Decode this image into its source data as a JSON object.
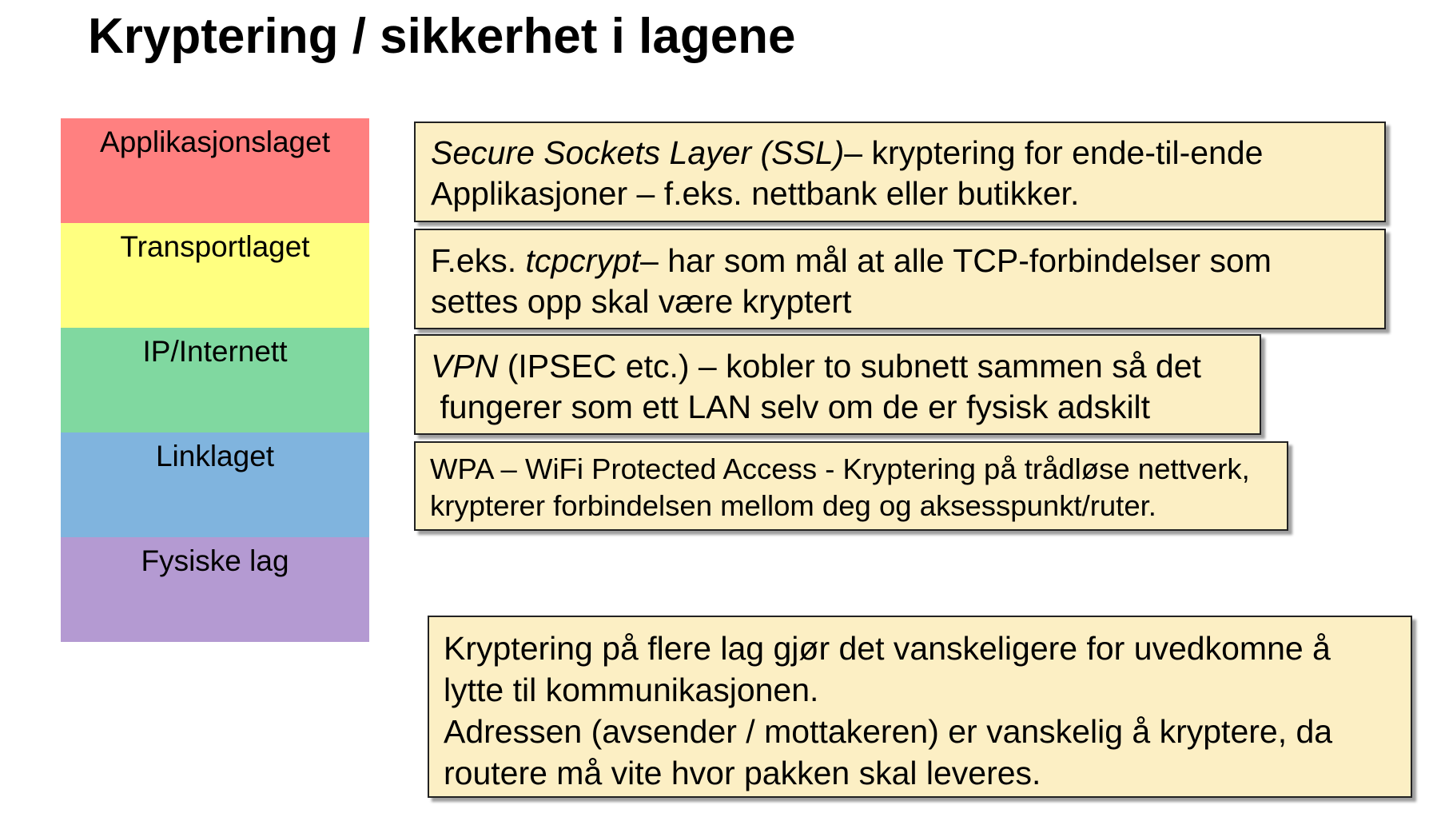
{
  "title": "Kryptering / sikkerhet i lagene",
  "layers": [
    {
      "label": "Applikasjonslaget",
      "color": "#ff8080"
    },
    {
      "label": "Transportlaget",
      "color": "#ffff80"
    },
    {
      "label": "IP/Internett",
      "color": "#80d8a0"
    },
    {
      "label": "Linklaget",
      "color": "#80b4de"
    },
    {
      "label": "Fysiske lag",
      "color": "#b49ad2"
    }
  ],
  "boxes": {
    "ssl": {
      "term": "Secure Sockets Layer (SSL)",
      "text1": "– kryptering for ende-til-ende",
      "line2": "Applikasjoner – f.eks. nettbank eller butikker."
    },
    "tcp": {
      "prefix": "F.eks. ",
      "term": "tcpcrypt",
      "text1": "– har som mål at alle TCP-forbindelser som",
      "line2": "settes opp skal være kryptert"
    },
    "vpn": {
      "term": "VPN",
      "text1": " (IPSEC etc.) – kobler to subnett sammen så det",
      "line2": " fungerer som ett LAN selv om de er fysisk adskilt"
    },
    "wpa": {
      "line1": "WPA – WiFi Protected Access - Kryptering på trådløse nettverk,",
      "line2": "krypterer forbindelsen mellom deg og aksesspunkt/ruter."
    },
    "note": {
      "line1": "Kryptering på flere lag gjør det vanskeligere for uvedkomne å",
      "line2": "lytte til kommunikasjonen.",
      "line3": "Adressen (avsender / mottakeren) er vanskelig å kryptere, da",
      "line4": "routere må vite hvor pakken skal leveres."
    }
  }
}
